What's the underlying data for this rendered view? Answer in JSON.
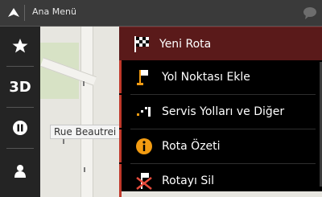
{
  "header": {
    "title": "Ana Menü"
  },
  "map": {
    "street_label": "Rue Beautrei"
  },
  "sidebar": {
    "zoom_mode_label": "3D"
  },
  "menu": {
    "items": [
      {
        "label": "Yeni Rota",
        "icon": "checkered-flag-icon",
        "active": true
      },
      {
        "label": "Yol Noktası Ekle",
        "icon": "waypoint-flag-icon",
        "active": false
      },
      {
        "label": "Servis Yolları ve Diğer",
        "icon": "detour-route-icon",
        "active": false
      },
      {
        "label": "Rota Özeti",
        "icon": "info-icon",
        "active": false
      },
      {
        "label": "Rotayı Sil",
        "icon": "delete-route-icon",
        "active": false
      }
    ]
  },
  "colors": {
    "accent_red": "#c0392b",
    "active_row": "#5a1a1a"
  }
}
